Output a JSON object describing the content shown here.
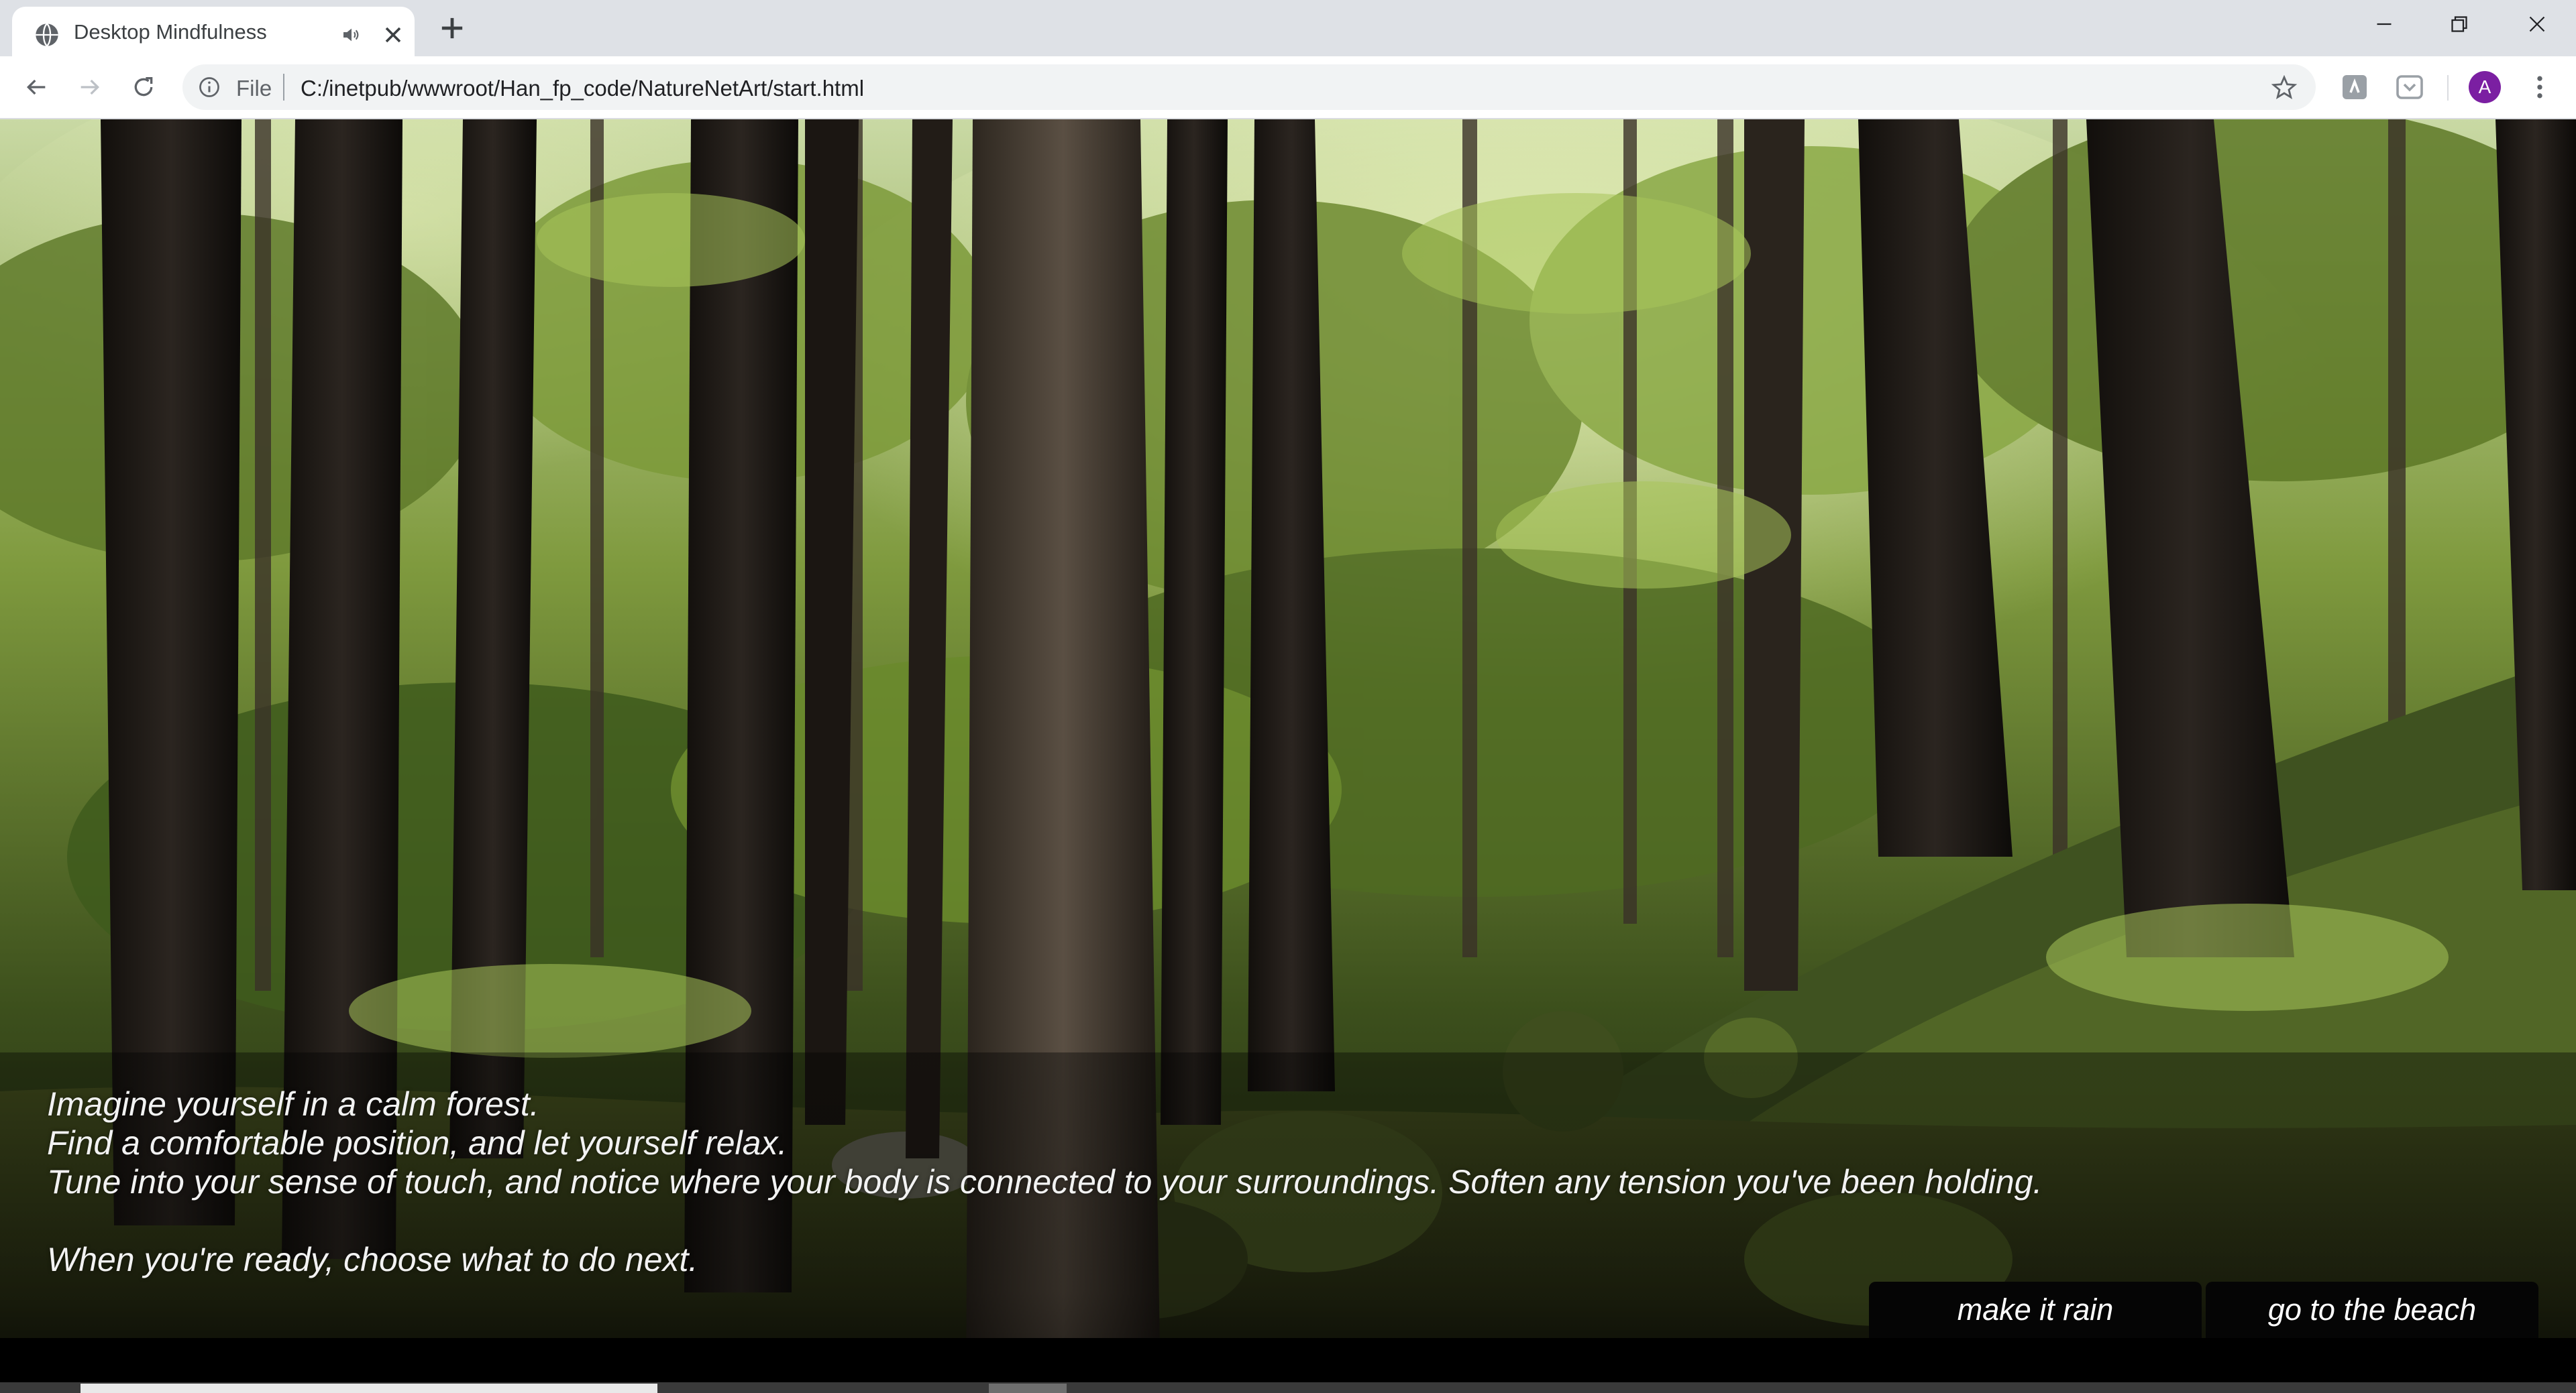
{
  "browser": {
    "tab": {
      "title": "Desktop Mindfulness",
      "favicon": "globe-icon",
      "audio_icon": "speaker-icon"
    },
    "address_bar": {
      "scheme_label": "File",
      "url": "C:/inetpub/wwwroot/Han_fp_code/NatureNetArt/start.html"
    },
    "profile_initial": "A"
  },
  "page": {
    "narration": {
      "line1": "Imagine yourself in a calm forest.",
      "line2": "Find a comfortable position, and let yourself relax.",
      "line3": "Tune into your sense of touch, and notice where your body is connected to your surroundings. Soften any tension you've been holding.",
      "line4": "When you're ready, choose what to do next."
    },
    "choices": {
      "rain": "make it rain",
      "beach": "go to the beach"
    }
  },
  "colors": {
    "tab_strip": "#dee1e6",
    "avatar": "#7b1fa2",
    "button_bg": "#050505"
  }
}
